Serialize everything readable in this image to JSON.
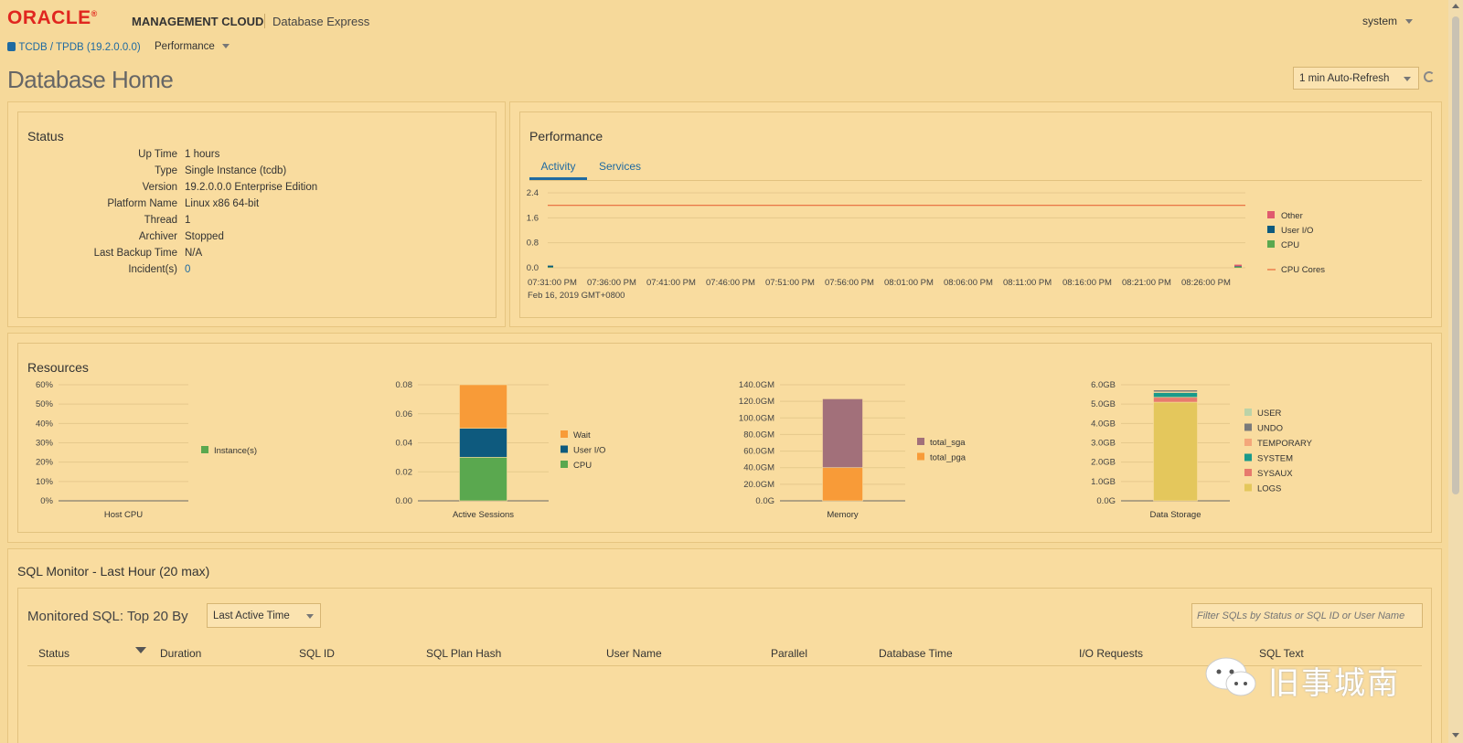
{
  "header": {
    "logo": "ORACLE",
    "logo_sup": "®",
    "product": "MANAGEMENT CLOUD",
    "app": "Database Express",
    "user": "system"
  },
  "subheader": {
    "db": "TCDB / TPDB (19.2.0.0.0)",
    "menu": "Performance"
  },
  "page": {
    "title": "Database Home",
    "refresh": "1 min Auto-Refresh"
  },
  "status": {
    "title": "Status",
    "rows": [
      {
        "label": "Up Time",
        "value": "1 hours"
      },
      {
        "label": "Type",
        "value": "Single Instance (tcdb)"
      },
      {
        "label": "Version",
        "value": "19.2.0.0.0 Enterprise Edition"
      },
      {
        "label": "Platform Name",
        "value": "Linux x86 64-bit"
      },
      {
        "label": "Thread",
        "value": "1"
      },
      {
        "label": "Archiver",
        "value": "Stopped"
      },
      {
        "label": "Last Backup Time",
        "value": "N/A"
      },
      {
        "label": "Incident(s)",
        "value": "0"
      }
    ]
  },
  "performance": {
    "title": "Performance",
    "tabs": [
      "Activity",
      "Services"
    ],
    "date_note": "Feb 16, 2019 GMT+0800"
  },
  "resources": {
    "title": "Resources"
  },
  "sqlmon": {
    "title": "SQL Monitor - Last Hour (20 max)",
    "subtitle": "Monitored SQL: Top 20 By",
    "sort": "Last Active Time",
    "filter_placeholder": "Filter SQLs by Status or SQL ID or User Name",
    "columns": [
      "Status",
      "Duration",
      "SQL ID",
      "SQL Plan Hash",
      "User Name",
      "Parallel",
      "Database Time",
      "I/O Requests",
      "SQL Text"
    ]
  },
  "watermark": "旧事城南",
  "colors": {
    "other": "#e05a6e",
    "userio": "#0e5a7e",
    "cpu": "#5aa84f",
    "cpucores": "#e8683a",
    "wait": "#f89b38",
    "sga": "#a2707a",
    "pga": "#f89b38",
    "instance": "#5aa84f",
    "user": "#bcd3a8",
    "undo": "#7a7a7a",
    "temporary": "#f4a77b",
    "system": "#1a9a8a",
    "sysaux": "#e77a6d",
    "logs": "#e4c75c"
  },
  "chart_data": [
    {
      "type": "area",
      "name": "activity",
      "x": [
        "07:31:00 PM",
        "07:36:00 PM",
        "07:41:00 PM",
        "07:46:00 PM",
        "07:51:00 PM",
        "07:56:00 PM",
        "08:01:00 PM",
        "08:06:00 PM",
        "08:11:00 PM",
        "08:16:00 PM",
        "08:21:00 PM",
        "08:26:00 PM"
      ],
      "yticks": [
        "2.4",
        "1.6",
        "0.8",
        "0.0"
      ],
      "ylim": [
        0,
        2.4
      ],
      "series": [
        {
          "name": "Other",
          "values": [
            0,
            0,
            0,
            0,
            0,
            0,
            0,
            0,
            0,
            0,
            0,
            0.05
          ]
        },
        {
          "name": "User I/O",
          "values": [
            0.05,
            0,
            0,
            0,
            0,
            0,
            0,
            0,
            0,
            0,
            0,
            0.02
          ]
        },
        {
          "name": "CPU",
          "values": [
            0.02,
            0,
            0,
            0,
            0,
            0,
            0,
            0,
            0,
            0,
            0,
            0.03
          ]
        },
        {
          "name": "CPU Cores",
          "values": [
            2,
            2,
            2,
            2,
            2,
            2,
            2,
            2,
            2,
            2,
            2,
            2
          ]
        }
      ]
    },
    {
      "type": "bar",
      "name": "host_cpu",
      "xlabel": "Host CPU",
      "yticks": [
        "60%",
        "50%",
        "40%",
        "30%",
        "20%",
        "10%",
        "0%"
      ],
      "ylim": [
        0,
        60
      ],
      "series": [
        {
          "name": "Instance(s)",
          "values": [
            0
          ]
        }
      ]
    },
    {
      "type": "bar",
      "name": "active_sessions",
      "xlabel": "Active Sessions",
      "yticks": [
        "0.08",
        "0.06",
        "0.04",
        "0.02",
        "0.00"
      ],
      "ylim": [
        0,
        0.08
      ],
      "series": [
        {
          "name": "Wait",
          "values": [
            0.03
          ]
        },
        {
          "name": "User I/O",
          "values": [
            0.02
          ]
        },
        {
          "name": "CPU",
          "values": [
            0.03
          ]
        }
      ]
    },
    {
      "type": "bar",
      "name": "memory",
      "xlabel": "Memory",
      "yticks": [
        "140.0GM",
        "120.0GM",
        "100.0GM",
        "80.0GM",
        "60.0GM",
        "40.0GM",
        "20.0GM",
        "0.0G"
      ],
      "ylim": [
        0,
        140
      ],
      "series": [
        {
          "name": "total_sga",
          "values": [
            83
          ]
        },
        {
          "name": "total_pga",
          "values": [
            40
          ]
        }
      ]
    },
    {
      "type": "bar",
      "name": "data_storage",
      "xlabel": "Data Storage",
      "yticks": [
        "6.0GB",
        "5.0GB",
        "4.0GB",
        "3.0GB",
        "2.0GB",
        "1.0GB",
        "0.0G"
      ],
      "ylim": [
        0,
        6
      ],
      "series": [
        {
          "name": "USER",
          "values": [
            0.02
          ]
        },
        {
          "name": "UNDO",
          "values": [
            0.1
          ]
        },
        {
          "name": "TEMPORARY",
          "values": [
            0.03
          ]
        },
        {
          "name": "SYSTEM",
          "values": [
            0.25
          ]
        },
        {
          "name": "SYSAUX",
          "values": [
            0.25
          ]
        },
        {
          "name": "LOGS",
          "values": [
            5.1
          ]
        }
      ]
    }
  ]
}
